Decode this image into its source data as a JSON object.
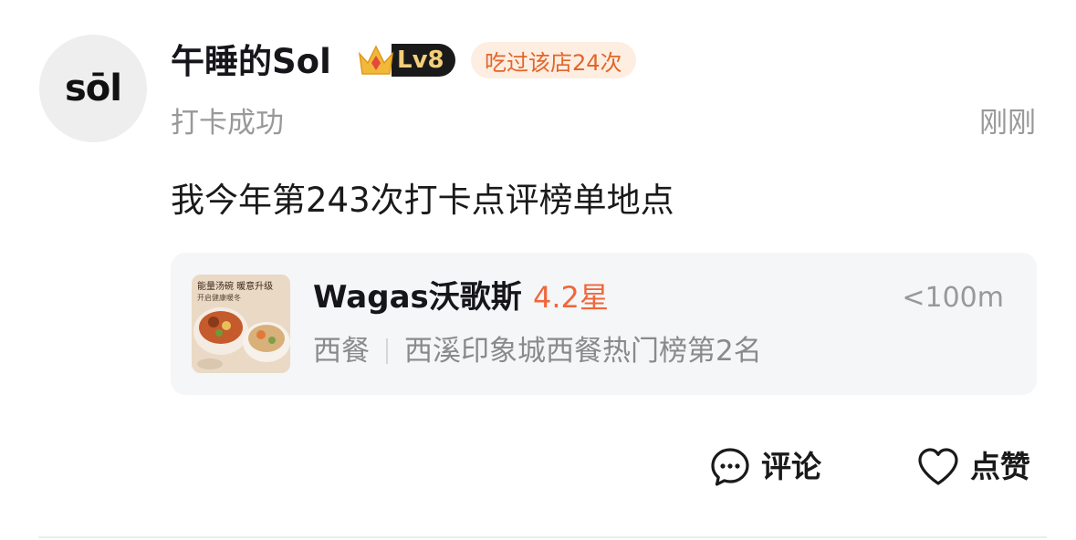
{
  "user": {
    "avatar_text": "sōl",
    "name": "午睡的Sol",
    "level": "Lv8",
    "visit_badge": "吃过该店24次"
  },
  "post": {
    "status": "打卡成功",
    "time": "刚刚",
    "text": "我今年第243次打卡点评榜单地点"
  },
  "shop": {
    "name": "Wagas沃歌斯",
    "rating": "4.2星",
    "distance": "<100m",
    "category": "西餐",
    "ranking": "西溪印象城西餐热门榜第2名",
    "thumb_caption_1": "能量汤碗 暖意升级",
    "thumb_caption_2": "开启健康暖冬"
  },
  "actions": {
    "comment": "评论",
    "like": "点赞"
  },
  "colors": {
    "accent_orange": "#f0673a",
    "badge_bg": "#fdeee1",
    "level_gold": "#f3cf7a"
  }
}
